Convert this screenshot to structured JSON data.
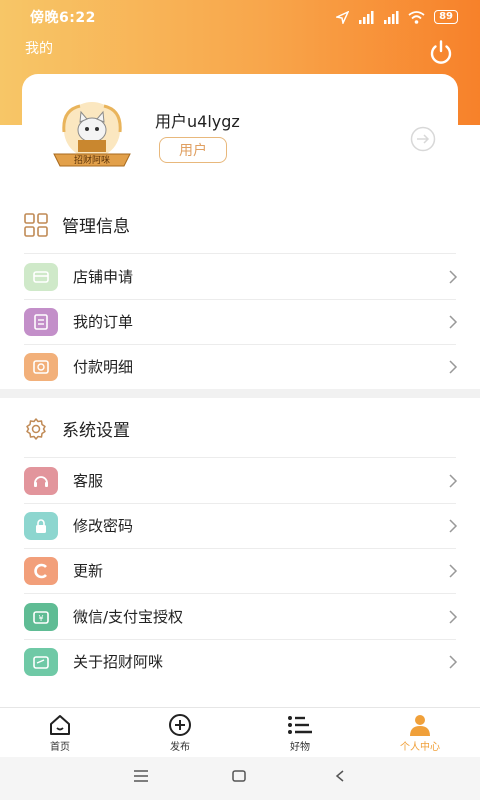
{
  "status_bar": {
    "time": "傍晚6:22",
    "battery": "89"
  },
  "header": {
    "title": "我的"
  },
  "profile": {
    "username": "用户u4lygz",
    "role": "用户",
    "avatar_text": "招财阿咪"
  },
  "sections": [
    {
      "title": "管理信息",
      "items": [
        {
          "label": "店铺申请",
          "color": "#cfe9c9"
        },
        {
          "label": "我的订单",
          "color": "#c38fc9"
        },
        {
          "label": "付款明细",
          "color": "#f2b07a"
        }
      ]
    },
    {
      "title": "系统设置",
      "items": [
        {
          "label": "客服",
          "color": "#e2959c"
        },
        {
          "label": "修改密码",
          "color": "#8dd6cf"
        },
        {
          "label": "更新",
          "color": "#f29f7a"
        },
        {
          "label": "微信/支付宝授权",
          "color": "#5fbc94"
        },
        {
          "label": "关于招财阿咪",
          "color": "#6fc9a6"
        }
      ]
    }
  ],
  "bottom_nav": [
    {
      "label": "首页",
      "icon": "home-icon"
    },
    {
      "label": "发布",
      "icon": "plus-circle-icon"
    },
    {
      "label": "好物",
      "icon": "list-icon"
    },
    {
      "label": "个人中心",
      "icon": "person-icon",
      "active": true
    }
  ],
  "colors": {
    "accent": "#f0a03a",
    "header_start": "#f7c667",
    "header_end": "#f7812a"
  }
}
